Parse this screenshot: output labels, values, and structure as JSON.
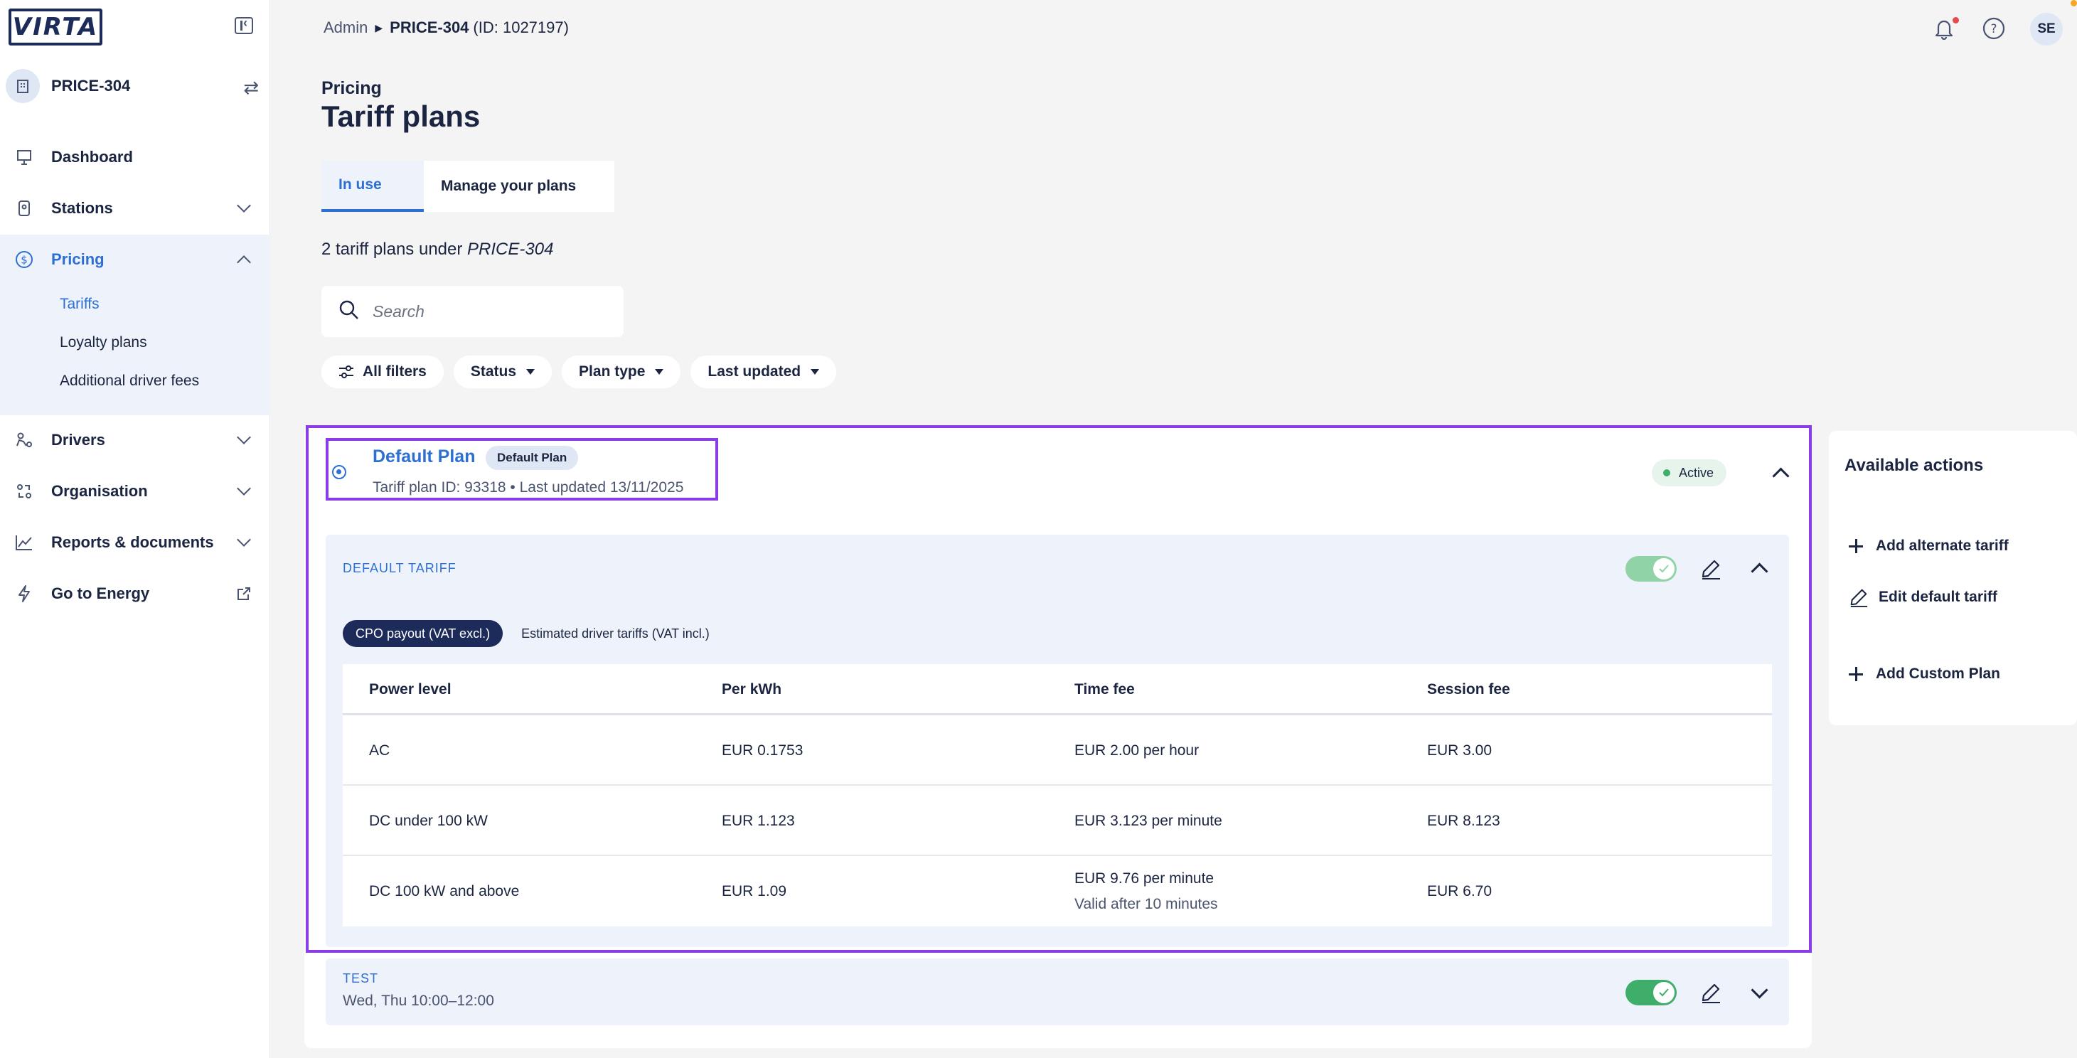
{
  "brand": {
    "logo_text": "VIRTA"
  },
  "org": {
    "name": "PRICE-304"
  },
  "nav": {
    "dashboard": "Dashboard",
    "stations": "Stations",
    "pricing": "Pricing",
    "pricing_sub": [
      "Tariffs",
      "Loyalty plans",
      "Additional driver fees"
    ],
    "drivers": "Drivers",
    "organisation": "Organisation",
    "reports": "Reports & documents",
    "energy": "Go to Energy"
  },
  "breadcrumb": {
    "root": "Admin",
    "current": "PRICE-304",
    "id": "(ID: 1027197)"
  },
  "user": {
    "initials": "SE"
  },
  "header": {
    "eyebrow": "Pricing",
    "title": "Tariff plans"
  },
  "tabs": [
    {
      "label": "In use",
      "active": true
    },
    {
      "label": "Manage your plans",
      "active": false
    }
  ],
  "summary": {
    "prefix": "2 tariff plans under ",
    "org": "PRICE-304"
  },
  "search": {
    "placeholder": "Search"
  },
  "filters": {
    "all": "All filters",
    "status": "Status",
    "plan_type": "Plan type",
    "last_updated": "Last updated"
  },
  "plan": {
    "name": "Default Plan",
    "badge": "Default Plan",
    "meta": "Tariff plan ID: 93318 • Last updated 13/11/2025",
    "status": "Active",
    "tariff": {
      "label": "DEFAULT TARIFF",
      "views": [
        "CPO payout (VAT excl.)",
        "Estimated driver tariffs (VAT incl.)"
      ],
      "columns": [
        "Power level",
        "Per kWh",
        "Time fee",
        "Session fee"
      ],
      "rows": [
        {
          "power": "AC",
          "kwh": "EUR 0.1753",
          "time": "EUR 2.00 per hour",
          "time_note": "",
          "session": "EUR 3.00"
        },
        {
          "power": "DC under 100 kW",
          "kwh": "EUR 1.123",
          "time": "EUR 3.123 per minute",
          "time_note": "",
          "session": "EUR 8.123"
        },
        {
          "power": "DC 100 kW and above",
          "kwh": "EUR 1.09",
          "time": "EUR 9.76 per minute",
          "time_note": "Valid after 10 minutes",
          "session": "EUR 6.70"
        }
      ]
    },
    "test": {
      "label": "TEST",
      "schedule": "Wed, Thu 10:00–12:00"
    }
  },
  "actions": {
    "title": "Available actions",
    "add_alternate": "Add alternate tariff",
    "edit_default": "Edit default tariff",
    "add_custom": "Add Custom Plan"
  },
  "colors": {
    "accent": "#2d6fd3",
    "navy": "#1c2b5a",
    "highlight": "#8a3ce8",
    "active_green": "#3fae6a"
  }
}
